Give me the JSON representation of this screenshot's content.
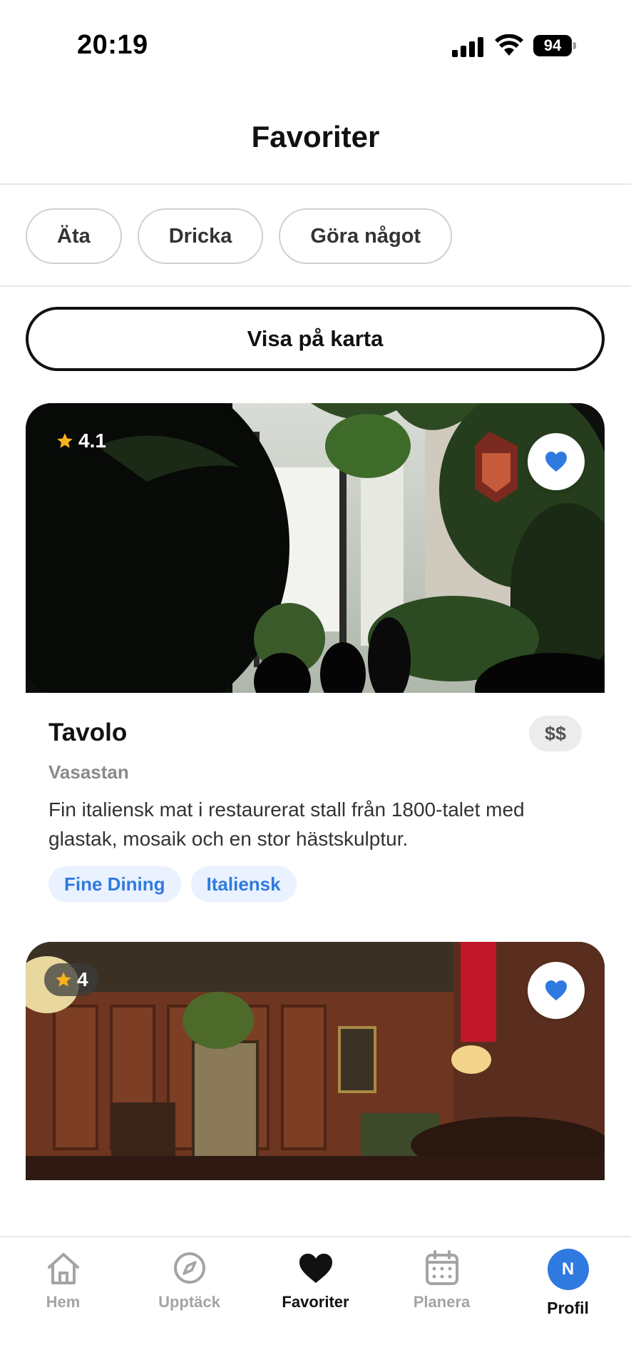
{
  "status": {
    "time": "20:19",
    "battery": "94"
  },
  "header": {
    "title": "Favoriter"
  },
  "filters": [
    {
      "label": "Äta"
    },
    {
      "label": "Dricka"
    },
    {
      "label": "Göra något"
    }
  ],
  "map_button": {
    "label": "Visa på karta"
  },
  "cards": [
    {
      "rating": "4.1",
      "name": "Tavolo",
      "price": "$$",
      "area": "Vasastan",
      "description": "Fin italiensk mat i restaurerat stall från 1800-talet med glastak, mosaik och en stor hästskulptur.",
      "tags": [
        "Fine Dining",
        "Italiensk"
      ],
      "favorited": true
    },
    {
      "rating": "4",
      "favorited": true
    }
  ],
  "tabbar": {
    "items": [
      {
        "label": "Hem",
        "icon": "home-icon"
      },
      {
        "label": "Upptäck",
        "icon": "compass-icon"
      },
      {
        "label": "Favoriter",
        "icon": "heart-icon"
      },
      {
        "label": "Planera",
        "icon": "calendar-icon"
      },
      {
        "label": "Profil",
        "icon": "avatar",
        "initial": "N"
      }
    ]
  },
  "colors": {
    "accent": "#2f7ae0",
    "tag_bg": "#eaf2ff",
    "star": "#f6b21b"
  }
}
